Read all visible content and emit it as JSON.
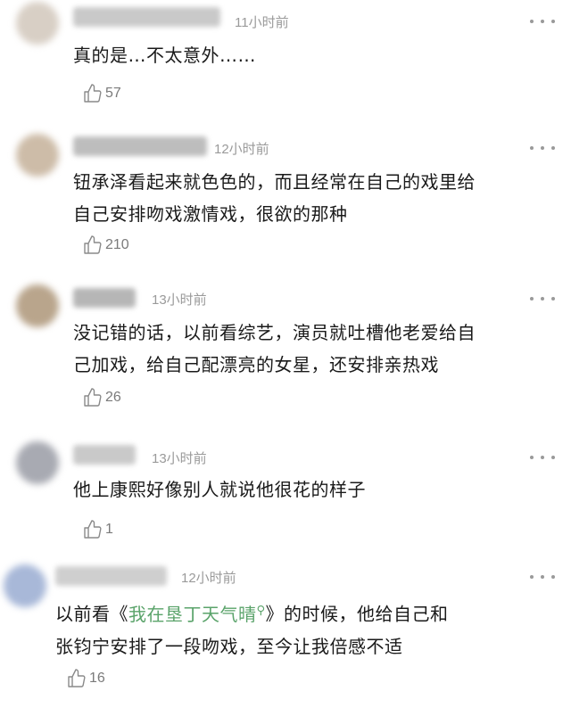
{
  "comments": [
    {
      "time": "11小时前",
      "text_lines": [
        "真的是…不太意外……"
      ],
      "likes": "57",
      "colors": {
        "avatar": "#d8cfc5",
        "name": "#c5c5c5"
      }
    },
    {
      "time": "12小时前",
      "text_lines": [
        "钮承泽看起来就色色的，而且经常在自己的戏里给",
        "自己安排吻戏激情戏，很欲的那种"
      ],
      "likes": "210",
      "colors": {
        "avatar": "#cdbca8",
        "name": "#bdbdbd"
      }
    },
    {
      "time": "13小时前",
      "text_lines": [
        "没记错的话，以前看综艺，演员就吐槽他老爱给自",
        "己加戏，给自己配漂亮的女星，还安排亲热戏"
      ],
      "likes": "26",
      "colors": {
        "avatar": "#b9a58c",
        "name": "#b6b6b6"
      }
    },
    {
      "time": "13小时前",
      "text_lines": [
        "他上康熙好像别人就说他很花的样子"
      ],
      "likes": "1",
      "colors": {
        "avatar": "#a8aab2",
        "name": "#c9c9c9"
      }
    },
    {
      "time": "12小时前",
      "text_prefix": "以前看《",
      "link_text": "我在垦丁天气晴",
      "text_suffix": "》的时候，他给自己和",
      "text_line2": "张钧宁安排了一段吻戏，至今让我倍感不适",
      "likes": "16",
      "colors": {
        "avatar": "#a8b8d8",
        "name": "#cfcfcf",
        "link": "#5aa36a"
      }
    }
  ]
}
